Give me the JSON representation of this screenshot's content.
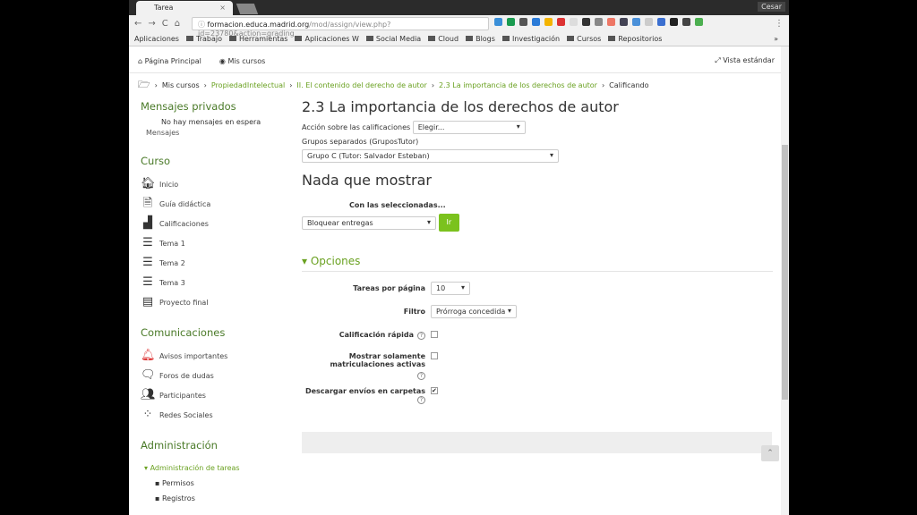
{
  "browser": {
    "tab_title": "Tarea",
    "user": "Cesar",
    "url_host": "formacion.educa.madrid.org",
    "url_path": "/mod/assign/view.php?id=23780&action=grading",
    "bookmarks": [
      "Aplicaciones",
      "Trabajo",
      "Herramientas",
      "Aplicaciones W",
      "Social Media",
      "Cloud",
      "Blogs",
      "Investigación",
      "Cursos",
      "Repositorios"
    ],
    "more": "»"
  },
  "nav": {
    "home": "Página Principal",
    "my_courses": "Mis cursos",
    "standard_view": "Vista estándar"
  },
  "breadcrumb": [
    "Mis cursos",
    "PropiedadIntelectual",
    "II. El contenido del derecho de autor",
    "2.3 La importancia de los derechos de autor",
    "Calificando"
  ],
  "sidebar": {
    "messages_title": "Mensajes privados",
    "no_messages": "No hay mensajes en espera",
    "messages_link": "Mensajes",
    "course_title": "Curso",
    "course_items": [
      "Inicio",
      "Guía didáctica",
      "Calificaciones",
      "Tema 1",
      "Tema 2",
      "Tema 3",
      "Proyecto final"
    ],
    "comm_title": "Comunicaciones",
    "comm_items": [
      "Avisos importantes",
      "Foros de dudas",
      "Participantes",
      "Redes Sociales"
    ],
    "admin_title": "Administración",
    "admin_section": "Administración de tareas",
    "admin_items": [
      "Permisos",
      "Registros"
    ]
  },
  "main": {
    "title": "2.3 La importancia de los derechos de autor",
    "grading_action_label": "Acción sobre las calificaciones",
    "grading_action_value": "Elegir...",
    "groups_label": "Grupos separados (GruposTutor)",
    "groups_value": "Grupo C (Tutor: Salvador Esteban)",
    "nothing": "Nada que mostrar",
    "with_selected": "Con las seleccionadas...",
    "bulk_value": "Bloquear entregas",
    "go": "Ir",
    "options_title": "Opciones",
    "per_page_label": "Tareas por página",
    "per_page_value": "10",
    "filter_label": "Filtro",
    "filter_value": "Prórroga concedida",
    "quick_grading": "Calificación rápida",
    "active_only": "Mostrar solamente matriculaciones activas",
    "download_folders": "Descargar envíos en carpetas",
    "quick_grading_checked": false,
    "active_only_checked": false,
    "download_folders_checked": true
  }
}
